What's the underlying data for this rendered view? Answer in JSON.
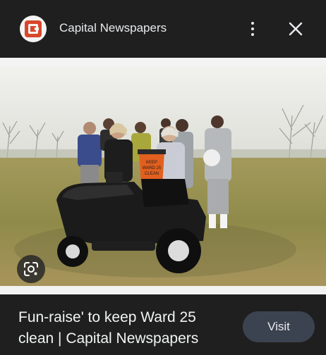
{
  "header": {
    "source_name": "Capital Newspapers",
    "logo_icon": "capital-newspapers-logo",
    "more_icon": "more-vert-icon",
    "close_icon": "close-icon"
  },
  "image": {
    "lens_icon": "google-lens-icon",
    "bin_sign_text": "KEEP WARD 25 CLEAN"
  },
  "result": {
    "caption": "Fun-raise' to keep Ward 25 clean | Capital Newspapers",
    "visit_label": "Visit"
  },
  "colors": {
    "background": "#1f1f1f",
    "visit_button": "#3c4350",
    "logo_brand": "#d9472b"
  }
}
